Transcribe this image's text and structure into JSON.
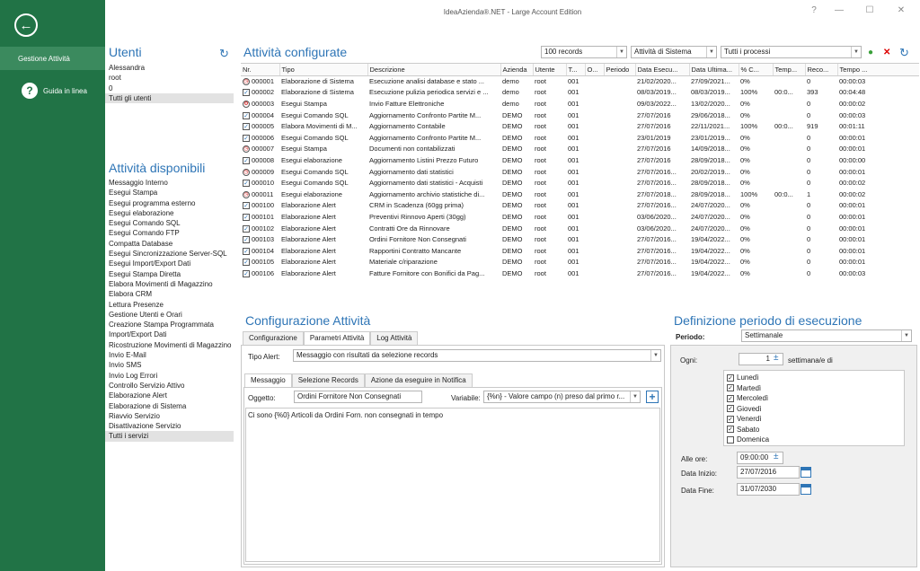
{
  "app": {
    "title": "IdeaAzienda®.NET - Large Account Edition"
  },
  "window": {
    "help": "?",
    "minimize": "—",
    "maximize": "☐",
    "close": "✕"
  },
  "sidebar": {
    "back_icon": "←",
    "items": [
      {
        "label": "Gestione Attività"
      },
      {
        "label": "Guida in linea",
        "icon": "?"
      }
    ]
  },
  "users": {
    "title": "Utenti",
    "refresh_icon": "↻",
    "items": [
      "Alessandra",
      "root",
      "0",
      "Tutti gli utenti"
    ]
  },
  "available": {
    "title": "Attività disponibili",
    "items": [
      "Messaggio Interno",
      "Esegui Stampa",
      "Esegui programma esterno",
      "Esegui elaborazione",
      "Esegui Comando SQL",
      "Esegui Comando FTP",
      "Compatta Database",
      "Esegui Sincronizzazione Server-SQL",
      "Esegui Import/Export Dati",
      "Esegui Stampa Diretta",
      "Elabora Movimenti di Magazzino",
      "Elabora CRM",
      "Lettura Presenze",
      "Gestione Utenti e Orari",
      "Creazione Stampa Programmata",
      "Import/Export Dati",
      "Ricostruzione Movimenti di Magazzino",
      "Invio E-Mail",
      "Invio SMS",
      "Invio Log Errori",
      "Controllo Servizio Attivo",
      "Elaborazione Alert",
      "Elaborazione di Sistema",
      "Riavvio Servizio",
      "Disattivazione Servizio",
      "Tutti i servizi"
    ]
  },
  "configured": {
    "title": "Attività configurate",
    "records_combo": "100 records",
    "type_combo": "Attività di Sistema",
    "process_combo": "Tutti i processi",
    "add_icon": "●",
    "delete_icon": "✕",
    "refresh_icon": "↻",
    "columns": [
      "Nr.",
      "Tipo",
      "Descrizione",
      "Azienda",
      "Utente",
      "T...",
      "O...",
      "Periodo",
      "Data Esecu...",
      "Data Ultima...",
      "% C...",
      "Temp...",
      "Reco...",
      "Tempo ..."
    ],
    "rows": [
      [
        "000001",
        "Elaborazione di Sistema",
        "Esecuzione analisi database e stato ...",
        "demo",
        "root",
        "001",
        "",
        "",
        "21/02/2020...",
        "27/09/2021...",
        "0%",
        "",
        "0",
        "00:00:03",
        "clock"
      ],
      [
        "000002",
        "Elaborazione di Sistema",
        "Esecuzione pulizia periodica servizi e ...",
        "demo",
        "root",
        "001",
        "",
        "",
        "08/03/2019...",
        "08/03/2019...",
        "100%",
        "00:0...",
        "393",
        "00:04:48",
        "check"
      ],
      [
        "000003",
        "Esegui Stampa",
        "Invio Fatture Elettroniche",
        "demo",
        "root",
        "001",
        "",
        "",
        "09/03/2022...",
        "13/02/2020...",
        "0%",
        "",
        "0",
        "00:00:02",
        "gear"
      ],
      [
        "000004",
        "Esegui Comando SQL",
        "Aggiornamento Confronto Partite M...",
        "DEMO",
        "root",
        "001",
        "",
        "",
        "27/07/2016",
        "29/06/2018...",
        "0%",
        "",
        "0",
        "00:00:03",
        "check"
      ],
      [
        "000005",
        "Elabora Movimenti di M...",
        "Aggiornamento Contabile",
        "DEMO",
        "root",
        "001",
        "",
        "",
        "27/07/2016",
        "22/11/2021...",
        "100%",
        "00:0...",
        "919",
        "00:01:11",
        "check"
      ],
      [
        "000006",
        "Esegui Comando SQL",
        "Aggiornamento Confronto Partite M...",
        "DEMO",
        "root",
        "001",
        "",
        "",
        "23/01/2019",
        "23/01/2019...",
        "0%",
        "",
        "0",
        "00:00:01",
        "check"
      ],
      [
        "000007",
        "Esegui Stampa",
        "Documenti non contabilizzati",
        "DEMO",
        "root",
        "001",
        "",
        "",
        "27/07/2016",
        "14/09/2018...",
        "0%",
        "",
        "0",
        "00:00:01",
        "clock"
      ],
      [
        "000008",
        "Esegui elaborazione",
        "Aggiornamento Listini Prezzo Futuro",
        "DEMO",
        "root",
        "001",
        "",
        "",
        "27/07/2016",
        "28/09/2018...",
        "0%",
        "",
        "0",
        "00:00:00",
        "check"
      ],
      [
        "000009",
        "Esegui Comando SQL",
        "Aggiornamento dati statistici",
        "DEMO",
        "root",
        "001",
        "",
        "",
        "27/07/2016...",
        "20/02/2019...",
        "0%",
        "",
        "0",
        "00:00:01",
        "clock"
      ],
      [
        "000010",
        "Esegui Comando SQL",
        "Aggiornamento dati statistici - Acquisti",
        "DEMO",
        "root",
        "001",
        "",
        "",
        "27/07/2016...",
        "28/09/2018...",
        "0%",
        "",
        "0",
        "00:00:02",
        "check"
      ],
      [
        "000011",
        "Esegui elaborazione",
        "Aggiornamento archivio statistiche di...",
        "DEMO",
        "root",
        "001",
        "",
        "",
        "27/07/2018...",
        "28/09/2018...",
        "100%",
        "00:0...",
        "1",
        "00:00:02",
        "clock"
      ],
      [
        "000100",
        "Elaborazione Alert",
        "CRM in Scadenza (60gg prima)",
        "DEMO",
        "root",
        "001",
        "",
        "",
        "27/07/2016...",
        "24/07/2020...",
        "0%",
        "",
        "0",
        "00:00:01",
        "check"
      ],
      [
        "000101",
        "Elaborazione Alert",
        "Preventivi Rinnovo Aperti (30gg)",
        "DEMO",
        "root",
        "001",
        "",
        "",
        "03/06/2020...",
        "24/07/2020...",
        "0%",
        "",
        "0",
        "00:00:01",
        "check"
      ],
      [
        "000102",
        "Elaborazione Alert",
        "Contratti Ore da Rinnovare",
        "DEMO",
        "root",
        "001",
        "",
        "",
        "03/06/2020...",
        "24/07/2020...",
        "0%",
        "",
        "0",
        "00:00:01",
        "check"
      ],
      [
        "000103",
        "Elaborazione Alert",
        "Ordini Fornitore Non Consegnati",
        "DEMO",
        "root",
        "001",
        "",
        "",
        "27/07/2016...",
        "19/04/2022...",
        "0%",
        "",
        "0",
        "00:00:01",
        "check"
      ],
      [
        "000104",
        "Elaborazione Alert",
        "Rapportini Contratto Mancante",
        "DEMO",
        "root",
        "001",
        "",
        "",
        "27/07/2016...",
        "19/04/2022...",
        "0%",
        "",
        "0",
        "00:00:01",
        "check"
      ],
      [
        "000105",
        "Elaborazione Alert",
        "Materiale c/riparazione",
        "DEMO",
        "root",
        "001",
        "",
        "",
        "27/07/2016...",
        "19/04/2022...",
        "0%",
        "",
        "0",
        "00:00:01",
        "check"
      ],
      [
        "000106",
        "Elaborazione Alert",
        "Fatture Fornitore con Bonifici da Pag...",
        "DEMO",
        "root",
        "001",
        "",
        "",
        "27/07/2016...",
        "19/04/2022...",
        "0%",
        "",
        "0",
        "00:00:03",
        "check"
      ]
    ]
  },
  "config": {
    "title": "Configurazione Attività",
    "tabs": [
      "Configurazione",
      "Parametri Attività",
      "Log Attività"
    ],
    "alert_type_label": "Tipo Alert:",
    "alert_type_value": "Messaggio con risultati da selezione records",
    "subtabs": [
      "Messaggio",
      "Selezione Records",
      "Azione da eseguire in Notifica"
    ],
    "subject_label": "Oggetto:",
    "subject_value": "Ordini Fornitore Non Consegnati",
    "variable_label": "Variabile:",
    "variable_value": "{%n} - Valore campo (n) preso dal primo r...",
    "add_icon": "+",
    "message_text": "Ci sono {%0} Articoli da Ordini Forn. non consegnati in tempo"
  },
  "schedule": {
    "title": "Definizione periodo di esecuzione",
    "period_label": "Periodo:",
    "period_value": "Settimanale",
    "every_label": "Ogni:",
    "every_value": "1",
    "every_suffix": "settimana/e di",
    "days": [
      {
        "label": "Lunedì",
        "checked": true
      },
      {
        "label": "Martedì",
        "checked": true
      },
      {
        "label": "Mercoledì",
        "checked": true
      },
      {
        "label": "Giovedì",
        "checked": true
      },
      {
        "label": "Venerdì",
        "checked": true
      },
      {
        "label": "Sabato",
        "checked": true
      },
      {
        "label": "Domenica",
        "checked": false
      }
    ],
    "time_label": "Alle ore:",
    "time_value": "09:00:00",
    "start_label": "Data Inizio:",
    "start_value": "27/07/2016",
    "end_label": "Data Fine:",
    "end_value": "31/07/2030"
  }
}
